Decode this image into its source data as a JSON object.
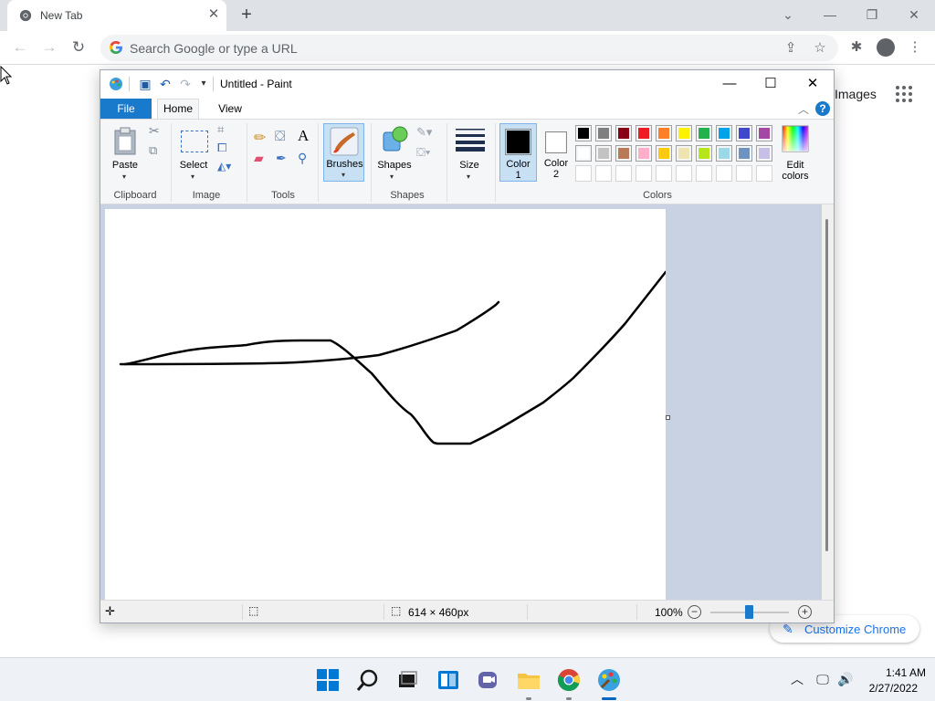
{
  "browser": {
    "tab_title": "New Tab",
    "tab_close": "✕",
    "new_tab": "+",
    "omnibox_placeholder": "Search Google or type a URL",
    "page_images_link": "Images",
    "customize_label": "Customize Chrome",
    "icons": [
      "chrome-icon",
      "back-icon",
      "forward-icon",
      "reload-icon",
      "google-g-icon",
      "share-icon",
      "star-icon",
      "extensions-icon",
      "profile-icon",
      "menu-icon",
      "apps-grid-icon"
    ]
  },
  "paint": {
    "title": "Untitled - Paint",
    "tabs": {
      "file": "File",
      "home": "Home",
      "view": "View"
    },
    "help": "?",
    "groups": {
      "clipboard": "Clipboard",
      "image": "Image",
      "tools": "Tools",
      "shapes": "Shapes",
      "colors": "Colors"
    },
    "buttons": {
      "paste": "Paste",
      "select": "Select",
      "brushes": "Brushes",
      "shapes": "Shapes",
      "size": "Size",
      "color1_line1": "Color",
      "color1_line2": "1",
      "color2_line1": "Color",
      "color2_line2": "2",
      "edit_colors_line1": "Edit",
      "edit_colors_line2": "colors"
    },
    "palette_row1": [
      "#000000",
      "#7f7f7f",
      "#880015",
      "#ed1c24",
      "#ff7f27",
      "#fff200",
      "#22b14c",
      "#00a2e8",
      "#3f48cc",
      "#a349a4"
    ],
    "palette_row2": [
      "#ffffff",
      "#c3c3c3",
      "#b97a57",
      "#ffaec9",
      "#ffc90e",
      "#efe4b0",
      "#b5e61d",
      "#99d9ea",
      "#7092be",
      "#c8bfe7"
    ],
    "color1": "#000000",
    "color2": "#ffffff",
    "status": {
      "dimensions": "614 × 460px",
      "zoom": "100%"
    }
  },
  "taskbar": {
    "apps": [
      "start-icon",
      "search-icon",
      "task-view-icon",
      "widgets-icon",
      "chat-icon",
      "file-explorer-icon",
      "chrome-icon",
      "paint-icon"
    ],
    "time": "1:41 AM",
    "date": "2/27/2022"
  }
}
